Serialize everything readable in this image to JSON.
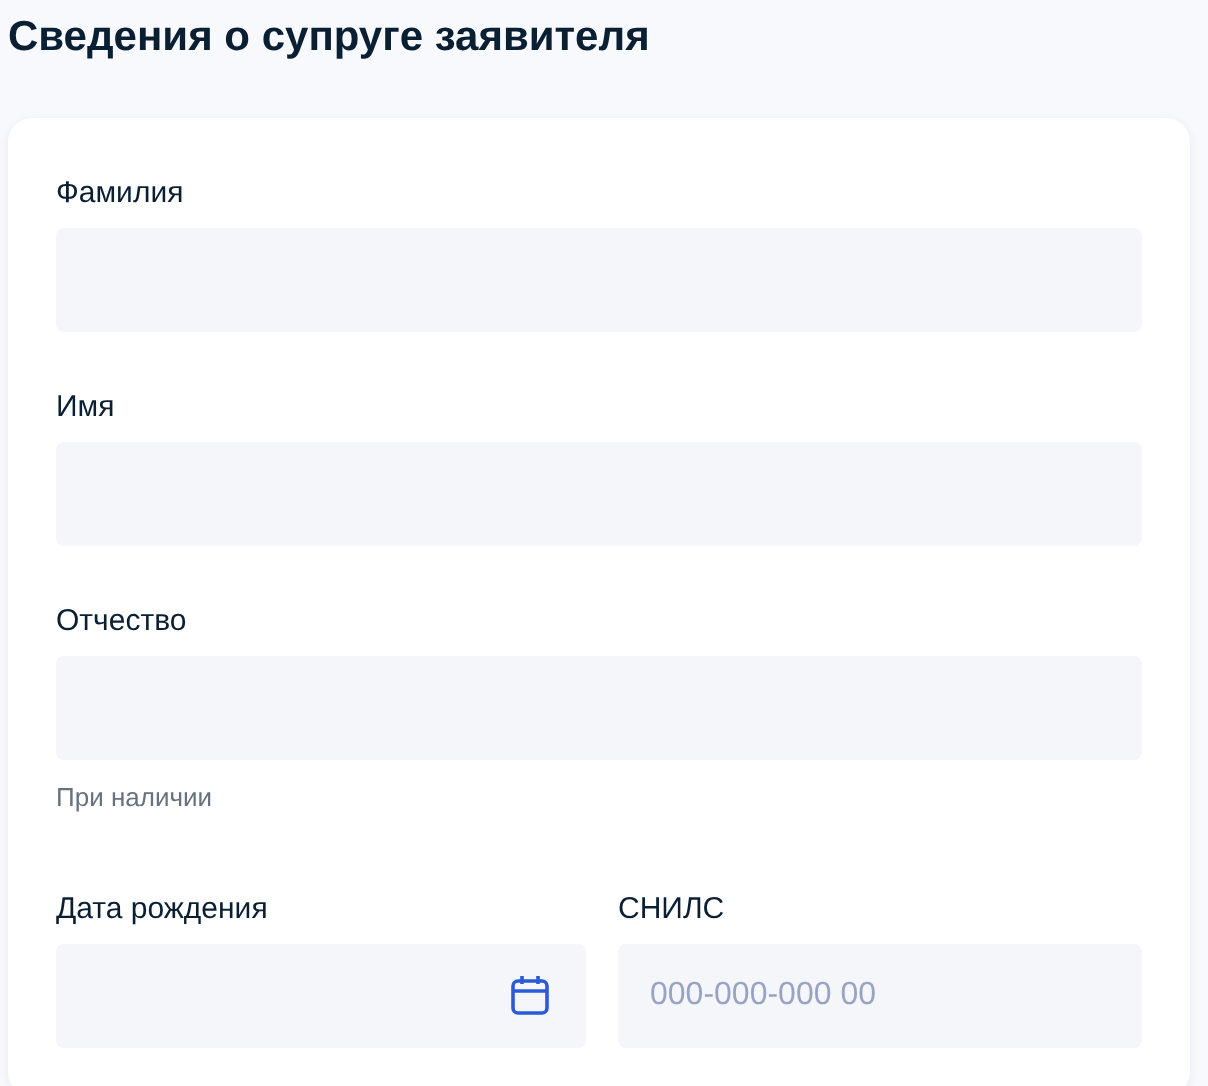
{
  "title": "Сведения о супруге заявителя",
  "rows": [
    {
      "fields": [
        {
          "kind": "text",
          "label": "Фамилия"
        }
      ]
    },
    {
      "fields": [
        {
          "kind": "text",
          "label": "Имя"
        }
      ]
    },
    {
      "fields": [
        {
          "kind": "text",
          "label": "Отчество",
          "hint": "При наличии"
        }
      ]
    },
    {
      "fields": [
        {
          "kind": "date",
          "label": "Дата рождения"
        },
        {
          "kind": "text",
          "label": "СНИЛС",
          "placeholder": "000-000-000 00"
        }
      ]
    }
  ]
}
